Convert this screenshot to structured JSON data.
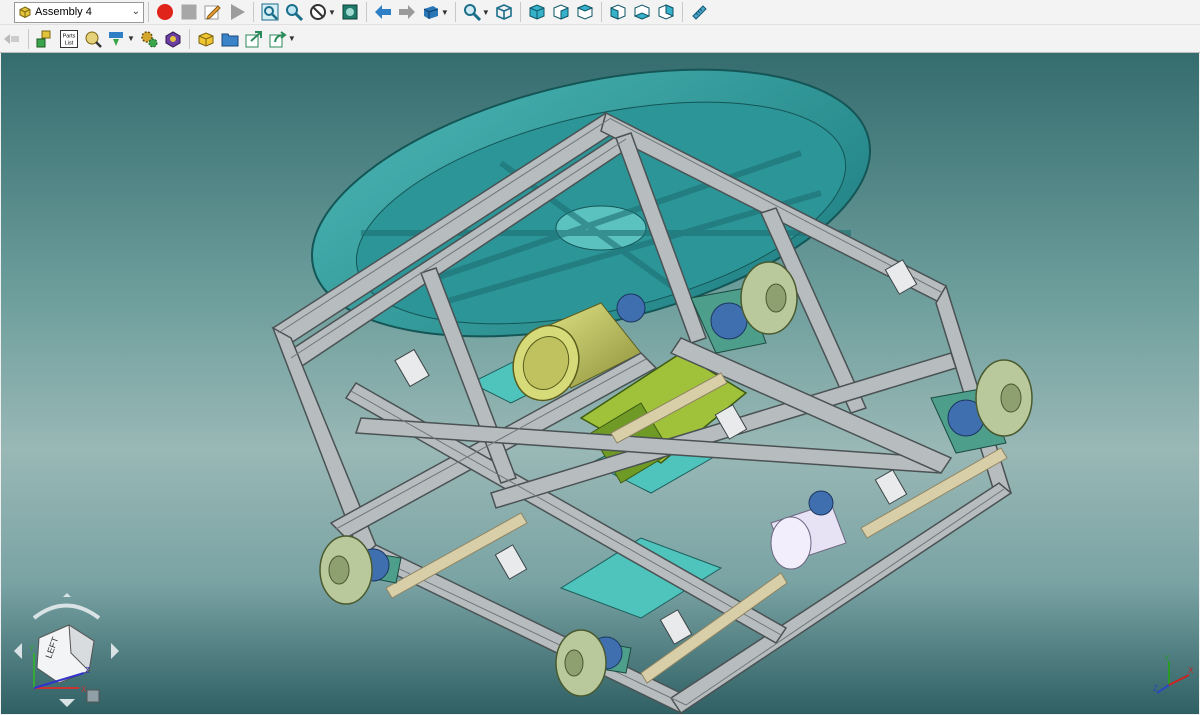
{
  "assembly_selector": {
    "value": "Assembly 4",
    "icon": "assembly-cube-icon"
  },
  "toolbar_row1": {
    "buttons": [
      "record-icon",
      "stop-icon",
      "sketch-pencil-icon",
      "play-icon",
      "zoom-fit-icon",
      "zoom-icon",
      "no-entry-icon",
      "fit-selection-icon",
      "arrow-left-icon",
      "arrow-right-icon",
      "view-orientation-icon",
      "zoom-window-icon",
      "wireframe-cube-icon",
      "view-front-icon",
      "view-back-icon",
      "view-top-icon",
      "view-bottom-icon",
      "view-left-icon",
      "view-right-icon",
      "ruler-icon"
    ]
  },
  "toolbar_row2": {
    "parts_list_top": "Parts",
    "parts_list_bottom": "List",
    "buttons": [
      "navigate-icon",
      "assembly-tree-icon",
      "parts-list-icon",
      "inspect-icon",
      "insert-part-icon",
      "settings-gears-icon",
      "components-icon",
      "new-part-icon",
      "open-folder-icon",
      "export-icon",
      "share-icon"
    ]
  },
  "view_cube": {
    "face_label": "LEFT",
    "axis_x": "X",
    "axis_y": "Y",
    "axis_z": "Z"
  },
  "axis_triad": {
    "x": "X",
    "y": "Y",
    "z": "Z"
  },
  "colors": {
    "frame": "#b7bcbf",
    "plate": "#3aa5a5",
    "motor": "#c9cc6a",
    "bearing": "#3f6fae",
    "wheel": "#b9c99b"
  }
}
